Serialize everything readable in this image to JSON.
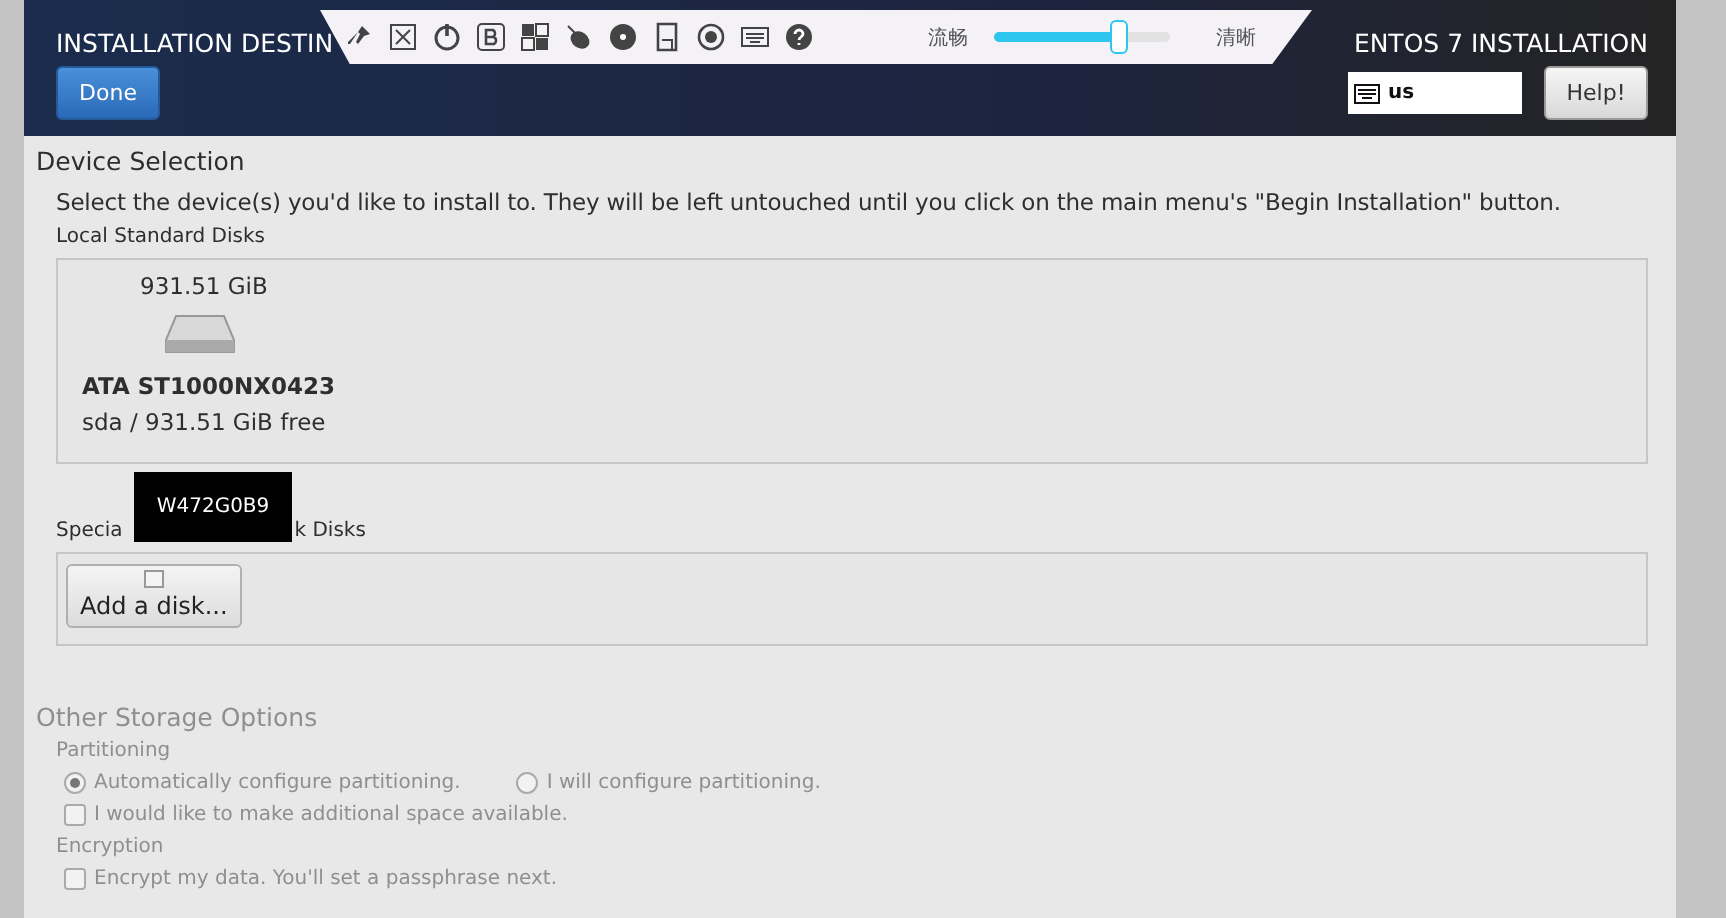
{
  "header": {
    "title": "INSTALLATION DESTIN",
    "product_title": "ENTOS 7 INSTALLATION",
    "done_button": "Done",
    "keyboard_layout": "us",
    "help_button": "Help!"
  },
  "remote_toolbar": {
    "slider_left_label": "流畅",
    "slider_right_label": "清晰",
    "level": 0.7
  },
  "device_selection": {
    "heading": "Device Selection",
    "description": "Select the device(s) you'd like to install to.  They will be left untouched until you click on the main menu's \"Begin Installation\" button.",
    "local_disks_label": "Local Standard Disks",
    "disks": [
      {
        "size": "931.51 GiB",
        "name": "ATA ST1000NX0423",
        "details": "sda / 931.51 GiB free",
        "selected": false
      }
    ],
    "special_disks_label_start": "Specia",
    "special_disks_label_end": "k Disks",
    "tooltip": "W472G0B9",
    "add_disk_button": "Add a disk..."
  },
  "other_storage": {
    "heading": "Other Storage Options",
    "partitioning_label": "Partitioning",
    "partitioning_options": [
      {
        "label": "Automatically configure partitioning.",
        "selected": true
      },
      {
        "label": "I will configure partitioning.",
        "selected": false
      }
    ],
    "additional_space": {
      "label": "I would like to make additional space available.",
      "checked": false
    },
    "encryption_label": "Encryption",
    "encrypt": {
      "label": "Encrypt my data. You'll set a passphrase next.",
      "checked": false
    }
  }
}
